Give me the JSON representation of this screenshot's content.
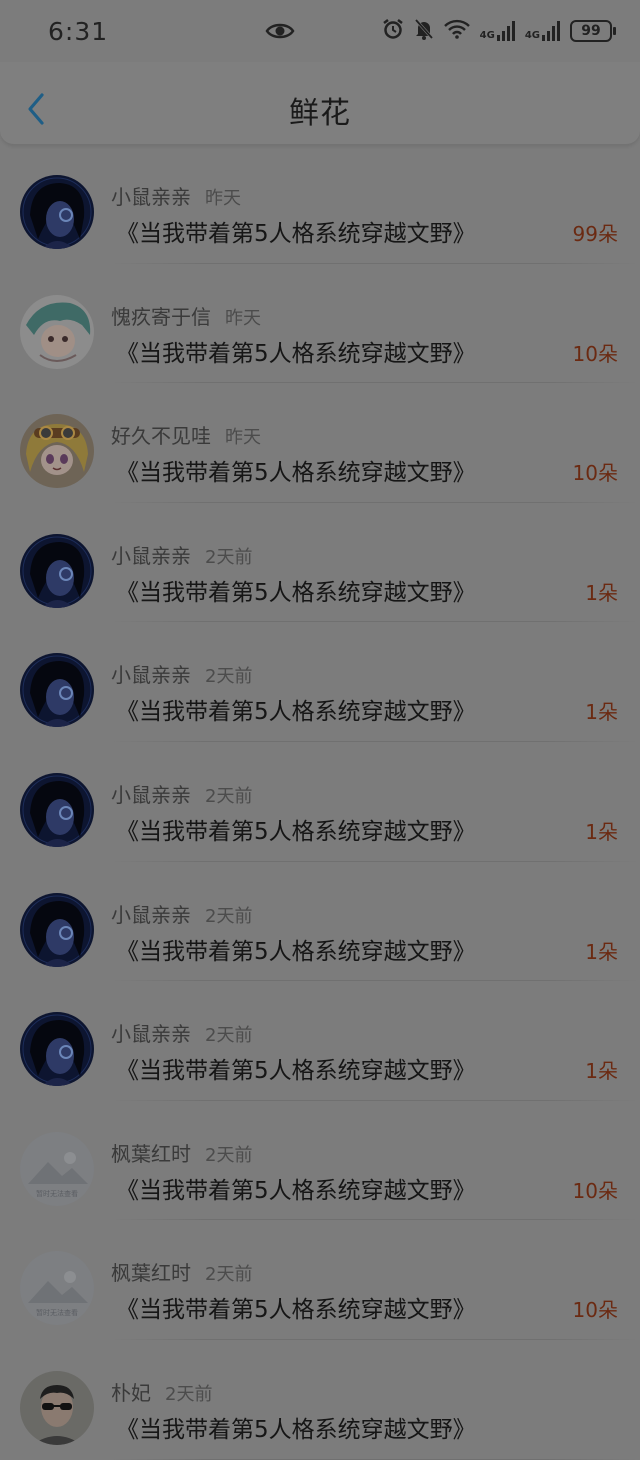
{
  "status_bar": {
    "time": "6:31",
    "network_1": "4G",
    "network_2": "4G",
    "battery": "99"
  },
  "nav": {
    "title": "鲜花"
  },
  "items": [
    {
      "name": "小鼠亲亲",
      "time": "昨天",
      "book": "《当我带着第5人格系统穿越文野》",
      "count": "99朵",
      "avatar": "dark-hair-avatar"
    },
    {
      "name": "愧疚寄于信",
      "time": "昨天",
      "book": "《当我带着第5人格系统穿越文野》",
      "count": "10朵",
      "avatar": "teal-anime-avatar"
    },
    {
      "name": "好久不见哇",
      "time": "昨天",
      "book": "《当我带着第5人格系统穿越文野》",
      "count": "10朵",
      "avatar": "blonde-anime-avatar"
    },
    {
      "name": "小鼠亲亲",
      "time": "2天前",
      "book": "《当我带着第5人格系统穿越文野》",
      "count": "1朵",
      "avatar": "dark-hair-avatar"
    },
    {
      "name": "小鼠亲亲",
      "time": "2天前",
      "book": "《当我带着第5人格系统穿越文野》",
      "count": "1朵",
      "avatar": "dark-hair-avatar"
    },
    {
      "name": "小鼠亲亲",
      "time": "2天前",
      "book": "《当我带着第5人格系统穿越文野》",
      "count": "1朵",
      "avatar": "dark-hair-avatar"
    },
    {
      "name": "小鼠亲亲",
      "time": "2天前",
      "book": "《当我带着第5人格系统穿越文野》",
      "count": "1朵",
      "avatar": "dark-hair-avatar"
    },
    {
      "name": "小鼠亲亲",
      "time": "2天前",
      "book": "《当我带着第5人格系统穿越文野》",
      "count": "1朵",
      "avatar": "dark-hair-avatar"
    },
    {
      "name": "枫葉红时",
      "time": "2天前",
      "book": "《当我带着第5人格系统穿越文野》",
      "count": "10朵",
      "avatar": "placeholder-landscape-avatar",
      "avatar_caption": "暂时无法查看"
    },
    {
      "name": "枫葉红时",
      "time": "2天前",
      "book": "《当我带着第5人格系统穿越文野》",
      "count": "10朵",
      "avatar": "placeholder-landscape-avatar",
      "avatar_caption": "暂时无法查看"
    },
    {
      "name": "朴妃",
      "time": "2天前",
      "book": "《当我带着第5人格系统穿越文野》",
      "count": "",
      "avatar": "photo-person-avatar"
    }
  ]
}
